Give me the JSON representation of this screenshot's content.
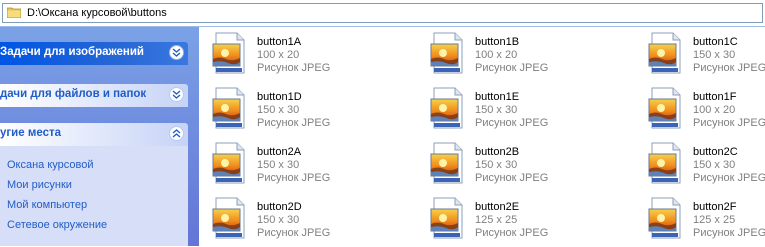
{
  "address": {
    "path": "D:\\Оксана курсовой\\buttons"
  },
  "taskpane": {
    "groups": [
      {
        "title": "Задачи для изображений"
      },
      {
        "title": "дачи для файлов и папок"
      },
      {
        "title": "угие места"
      }
    ],
    "links": [
      "Оксана курсовой",
      "Мои рисунки",
      "Мой компьютер",
      "Сетевое окружение"
    ]
  },
  "files": [
    {
      "name": "button1A",
      "dims": "100 x 20",
      "type": "Рисунок JPEG"
    },
    {
      "name": "button1B",
      "dims": "100 x 20",
      "type": "Рисунок JPEG"
    },
    {
      "name": "button1C",
      "dims": "150 x 30",
      "type": "Рисунок JPEG"
    },
    {
      "name": "button1D",
      "dims": "150 x 30",
      "type": "Рисунок JPEG"
    },
    {
      "name": "button1E",
      "dims": "150 x 30",
      "type": "Рисунок JPEG"
    },
    {
      "name": "button1F",
      "dims": "100 x 20",
      "type": "Рисунок JPEG"
    },
    {
      "name": "button2A",
      "dims": "150 x 30",
      "type": "Рисунок JPEG"
    },
    {
      "name": "button2B",
      "dims": "150 x 30",
      "type": "Рисунок JPEG"
    },
    {
      "name": "button2C",
      "dims": "150 x 30",
      "type": "Рисунок JPEG"
    },
    {
      "name": "button2D",
      "dims": "150 x 30",
      "type": "Рисунок JPEG"
    },
    {
      "name": "button2E",
      "dims": "125 x 25",
      "type": "Рисунок JPEG"
    },
    {
      "name": "button2F",
      "dims": "125 x 25",
      "type": "Рисунок JPEG"
    }
  ],
  "icons": {
    "address": "folder-icon",
    "file": "jpeg-file-icon",
    "collapse": "chevron-up-icon",
    "expand": "chevron-down-icon"
  },
  "colors": {
    "link": "#215dc6",
    "pane_top": "#7ba2e7",
    "pane_bottom": "#6375d6",
    "header_dark": "#0055e5"
  }
}
